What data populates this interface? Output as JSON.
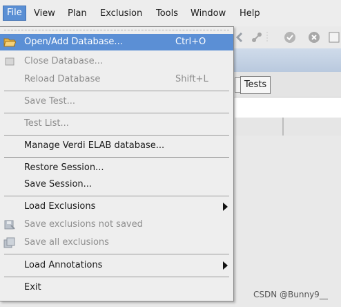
{
  "menubar": {
    "items": [
      {
        "label": "File",
        "key": "F"
      },
      {
        "label": "View",
        "key": "i"
      },
      {
        "label": "Plan",
        "key": "P"
      },
      {
        "label": "Exclusion",
        "key": "E"
      },
      {
        "label": "Tools",
        "key": "l"
      },
      {
        "label": "Window",
        "key": "W"
      },
      {
        "label": "Help",
        "key": "H"
      }
    ]
  },
  "tabs": {
    "tests_label": "Tests"
  },
  "file_menu": {
    "open": {
      "label": "Open/Add Database...",
      "shortcut": "Ctrl+O"
    },
    "close": {
      "label": "Close Database..."
    },
    "reload": {
      "label": "Reload Database",
      "shortcut": "Shift+L"
    },
    "save_test": {
      "label": "Save Test..."
    },
    "test_list": {
      "label": "Test List..."
    },
    "manage": {
      "label": "Manage Verdi ELAB database..."
    },
    "restore": {
      "label": "Restore Session..."
    },
    "save_session": {
      "label": "Save Session..."
    },
    "load_exclusions": {
      "label": "Load Exclusions"
    },
    "save_exclusions_not_saved": {
      "label": "Save exclusions not saved"
    },
    "save_all_exclusions": {
      "label": "Save all exclusions"
    },
    "load_annotations": {
      "label": "Load Annotations"
    },
    "exit": {
      "label": "Exit"
    }
  },
  "watermark": "CSDN @Bunny9__",
  "colors": {
    "highlight": "#5b8fd5",
    "disabled_text": "#8d8d8d",
    "menu_bg": "#eeeeee"
  }
}
